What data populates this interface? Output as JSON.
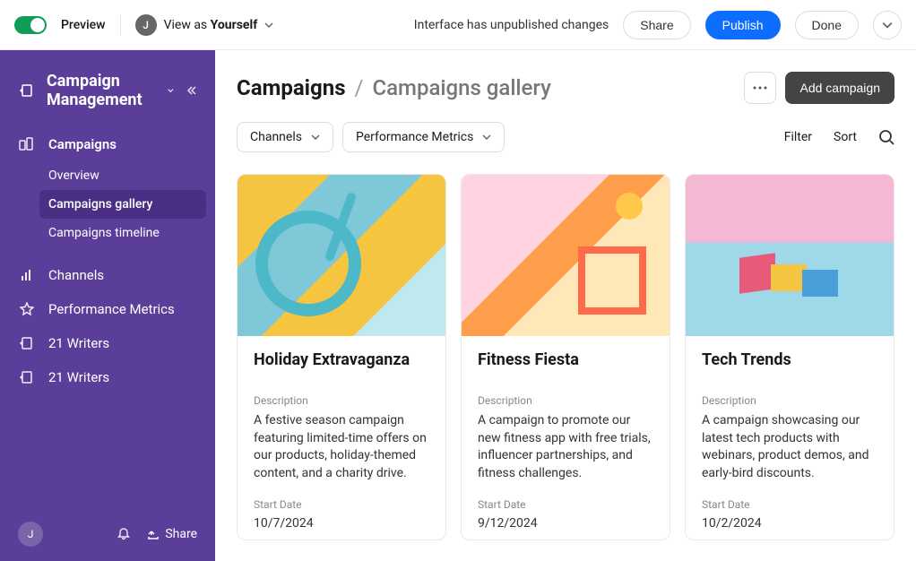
{
  "topbar": {
    "preview_label": "Preview",
    "avatar_letter": "J",
    "view_as_prefix": "View as ",
    "view_as_value": "Yourself",
    "status": "Interface has unpublished changes",
    "share": "Share",
    "publish": "Publish",
    "done": "Done"
  },
  "sidebar": {
    "title": "Campaign Management",
    "sections": [
      {
        "label": "Campaigns",
        "icon": "campaigns"
      }
    ],
    "subs": [
      {
        "label": "Overview",
        "active": false
      },
      {
        "label": "Campaigns gallery",
        "active": true
      },
      {
        "label": "Campaigns timeline",
        "active": false
      }
    ],
    "items": [
      {
        "label": "Channels",
        "icon": "bars"
      },
      {
        "label": "Performance Metrics",
        "icon": "star"
      },
      {
        "label": "21 Writers",
        "icon": "page"
      },
      {
        "label": "21 Writers",
        "icon": "page"
      }
    ],
    "footer": {
      "avatar_letter": "J",
      "share": "Share"
    }
  },
  "page": {
    "breadcrumb_root": "Campaigns",
    "breadcrumb_current": "Campaigns gallery",
    "add_button": "Add campaign",
    "filters": [
      {
        "label": "Channels"
      },
      {
        "label": "Performance Metrics"
      }
    ],
    "filter_link": "Filter",
    "sort_link": "Sort"
  },
  "cards": [
    {
      "title": "Holiday Extravaganza",
      "desc_label": "Description",
      "description": "A festive season campaign featuring limited-time offers on our products, holiday-themed content, and a charity drive.",
      "start_label": "Start Date",
      "start_date": "10/7/2024"
    },
    {
      "title": "Fitness Fiesta",
      "desc_label": "Description",
      "description": "A campaign to promote our new fitness app with free trials, influencer partnerships, and fitness challenges.",
      "start_label": "Start Date",
      "start_date": "9/12/2024"
    },
    {
      "title": "Tech Trends",
      "desc_label": "Description",
      "description": "A campaign showcasing our latest tech products with webinars, product demos, and early-bird discounts.",
      "start_label": "Start Date",
      "start_date": "10/2/2024"
    }
  ]
}
